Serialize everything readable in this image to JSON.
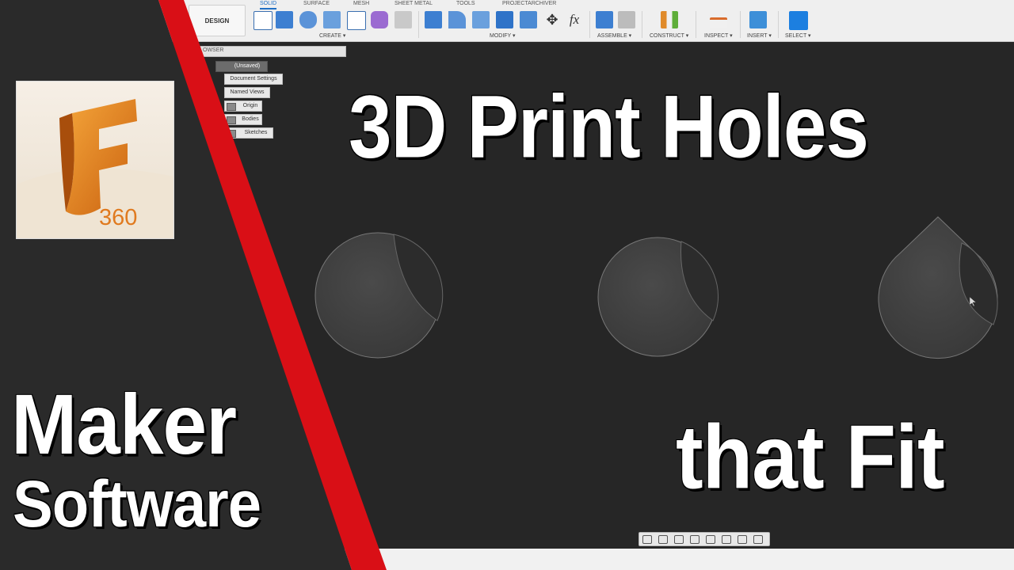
{
  "toolbar": {
    "workspace": "DESIGN",
    "tabs": [
      "SOLID",
      "SURFACE",
      "MESH",
      "SHEET METAL",
      "TOOLS",
      "PROJECTARCHIVER"
    ],
    "groups": [
      "CREATE ▾",
      "MODIFY ▾",
      "ASSEMBLE ▾",
      "CONSTRUCT ▾",
      "INSPECT ▾",
      "INSERT ▾",
      "SELECT ▾"
    ],
    "accent": "#1f6fc5"
  },
  "browser": {
    "title": "OWSER",
    "root": "(Unsaved)",
    "items": [
      "Document Settings",
      "Named Views",
      "Origin",
      "Bodies",
      "Sketches"
    ]
  },
  "thumbnail": {
    "logo_number": "360",
    "title_line1": "3D Print Holes",
    "title_line2": "that Fit",
    "brand_line1": "Maker",
    "brand_line2": "Software",
    "stripe_color": "#d90f16",
    "logo_color": "#e07a1f"
  },
  "icons": {
    "fx": "fx",
    "move": "✥"
  }
}
